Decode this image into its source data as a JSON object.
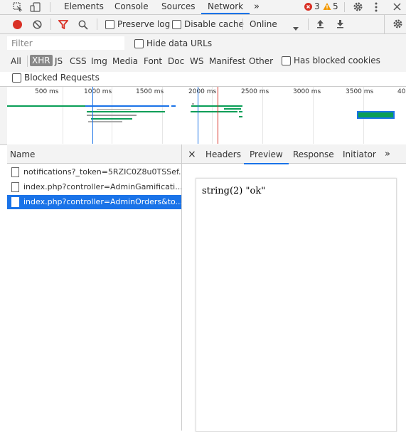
{
  "tabs": [
    "Elements",
    "Console",
    "Sources",
    "Network"
  ],
  "tabs_more": "»",
  "errors_count": "3",
  "warnings_count": "5",
  "toolbar": {
    "preserve_log": "Preserve log",
    "disable_cache": "Disable cache",
    "throttle": "Online"
  },
  "filter": {
    "placeholder": "Filter",
    "hide_data_urls": "Hide data URLs",
    "types": [
      "All",
      "XHR",
      "JS",
      "CSS",
      "Img",
      "Media",
      "Font",
      "Doc",
      "WS",
      "Manifest",
      "Other"
    ],
    "has_blocked_cookies": "Has blocked cookies",
    "blocked_requests": "Blocked Requests"
  },
  "timeline_ticks": [
    "500 ms",
    "1000 ms",
    "1500 ms",
    "2000 ms",
    "2500 ms",
    "3000 ms",
    "3500 ms",
    "400"
  ],
  "name_header": "Name",
  "requests": [
    "notifications?_token=5RZIC0Z8u0TSSef...",
    "index.php?controller=AdminGamificati...",
    "index.php?controller=AdminOrders&to..."
  ],
  "detail_close": "×",
  "detail_tabs": [
    "Headers",
    "Preview",
    "Response",
    "Initiator"
  ],
  "detail_more": "»",
  "preview_text": "string(2) \"ok\"",
  "colors": {
    "accent": "#1a73e8",
    "error": "#d93025",
    "warning": "#f29900",
    "bar_green": "#0a9e57",
    "bar_blue": "#1a73e8"
  }
}
